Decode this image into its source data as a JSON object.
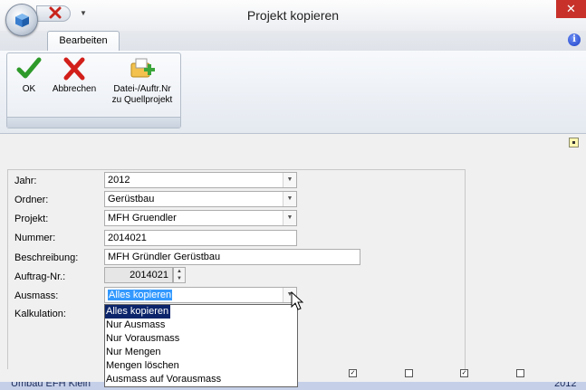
{
  "window": {
    "title": "Projekt kopieren",
    "close_label": "✕"
  },
  "tabs": [
    {
      "label": "Bearbeiten"
    }
  ],
  "ribbon": {
    "ok_label": "OK",
    "cancel_label": "Abbrechen",
    "file_label_1": "Datei-/Auftr.Nr",
    "file_label_2": "zu Quellprojekt"
  },
  "form": {
    "jahr": {
      "label": "Jahr:",
      "value": "2012"
    },
    "ordner": {
      "label": "Ordner:",
      "value": "Gerüstbau"
    },
    "projekt": {
      "label": "Projekt:",
      "value": "MFH Gruendler"
    },
    "nummer": {
      "label": "Nummer:",
      "value": "2014021"
    },
    "beschreibung": {
      "label": "Beschreibung:",
      "value": "MFH Gründler Gerüstbau"
    },
    "auftrag": {
      "label": "Auftrag-Nr.:",
      "value": "2014021"
    },
    "ausmass": {
      "label": "Ausmass:",
      "value": "Alles kopieren"
    },
    "kalkulation": {
      "label": "Kalkulation:"
    }
  },
  "ausmass_options": [
    "Alles kopieren",
    "Nur Ausmass",
    "Nur Vorausmass",
    "Nur Mengen",
    "Mengen löschen",
    "Ausmass auf Vorausmass"
  ],
  "background_row": {
    "text": "Umbau EFH Klein",
    "year": "2012"
  },
  "colors": {
    "close": "#c7312a",
    "selection": "#0b246a",
    "highlight": "#3399ff"
  }
}
